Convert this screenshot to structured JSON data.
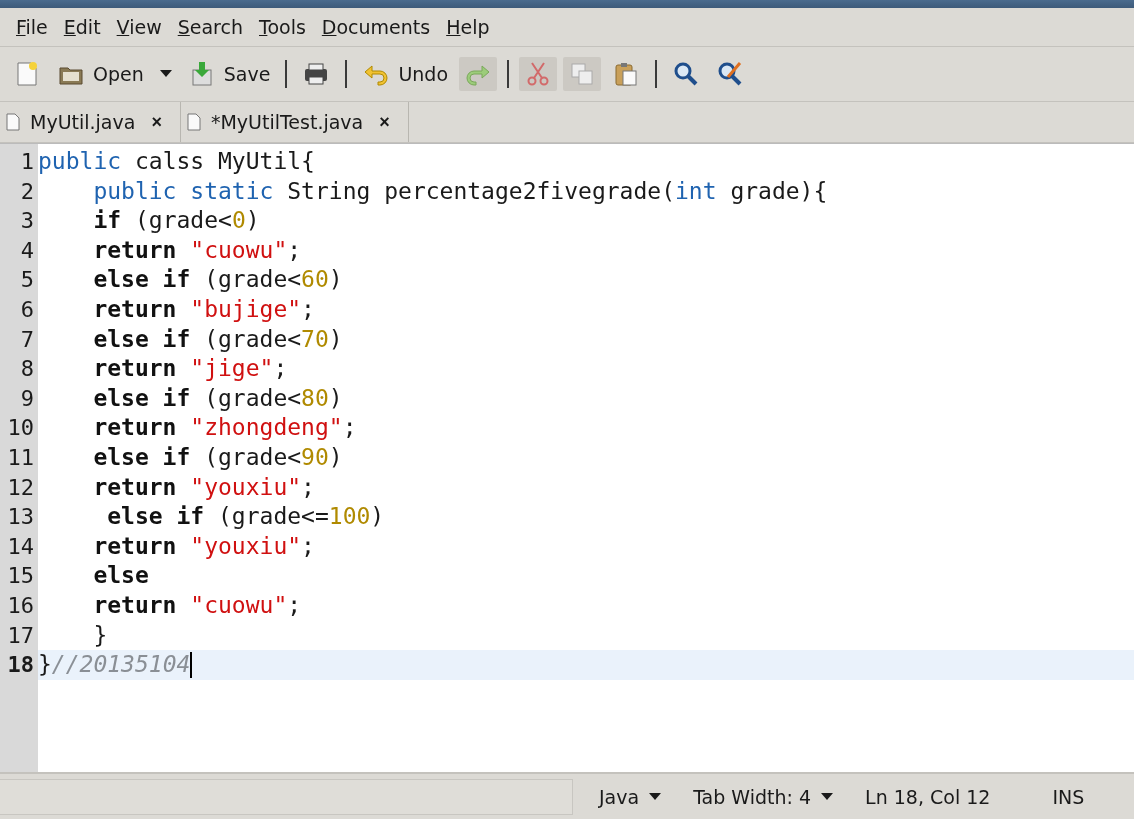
{
  "menu": [
    {
      "label": "File"
    },
    {
      "label": "Edit"
    },
    {
      "label": "View"
    },
    {
      "label": "Search"
    },
    {
      "label": "Tools"
    },
    {
      "label": "Documents"
    },
    {
      "label": "Help"
    }
  ],
  "toolbar": [
    {
      "kind": "new",
      "disabled": false
    },
    {
      "kind": "open",
      "label": "Open",
      "disabled": false
    },
    {
      "kind": "dropdown",
      "disabled": false
    },
    {
      "kind": "save",
      "label": "Save",
      "disabled": false
    },
    {
      "kind": "separator"
    },
    {
      "kind": "print",
      "disabled": false
    },
    {
      "kind": "separator"
    },
    {
      "kind": "undo",
      "label": "Undo",
      "disabled": false
    },
    {
      "kind": "redo",
      "disabled": true
    },
    {
      "kind": "separator"
    },
    {
      "kind": "cut",
      "disabled": true
    },
    {
      "kind": "copy",
      "disabled": true
    },
    {
      "kind": "paste",
      "disabled": false
    },
    {
      "kind": "separator"
    },
    {
      "kind": "find",
      "disabled": false
    },
    {
      "kind": "replace",
      "disabled": false
    }
  ],
  "tabs": [
    {
      "label": "MyUtil.java",
      "close": "×"
    },
    {
      "label": "*MyUtilTest.java",
      "close": "×"
    }
  ],
  "editor": {
    "lines": [
      {
        "number": "1",
        "current": false,
        "tokens": [
          {
            "kind": "keyword",
            "text": "public"
          },
          {
            "kind": "plain",
            "text": " calss MyUtil{"
          }
        ]
      },
      {
        "number": "2",
        "current": false,
        "tokens": [
          {
            "kind": "keyword",
            "text": "    public static"
          },
          {
            "kind": "plain",
            "text": " String percentage2fivegrade("
          },
          {
            "kind": "keyword",
            "text": "int"
          },
          {
            "kind": "plain",
            "text": " grade){"
          }
        ]
      },
      {
        "number": "3",
        "current": false,
        "tokens": [
          {
            "kind": "bold",
            "text": "    if"
          },
          {
            "kind": "plain",
            "text": " (grade<"
          },
          {
            "kind": "number",
            "text": "0"
          },
          {
            "kind": "plain",
            "text": ")"
          }
        ]
      },
      {
        "number": "4",
        "current": false,
        "tokens": [
          {
            "kind": "bold",
            "text": "    return"
          },
          {
            "kind": "string",
            "text": " \"cuowu\""
          },
          {
            "kind": "plain",
            "text": ";"
          }
        ]
      },
      {
        "number": "5",
        "current": false,
        "tokens": [
          {
            "kind": "bold",
            "text": "    else if"
          },
          {
            "kind": "plain",
            "text": " (grade<"
          },
          {
            "kind": "number",
            "text": "60"
          },
          {
            "kind": "plain",
            "text": ")"
          }
        ]
      },
      {
        "number": "6",
        "current": false,
        "tokens": [
          {
            "kind": "bold",
            "text": "    return"
          },
          {
            "kind": "string",
            "text": " \"bujige\""
          },
          {
            "kind": "plain",
            "text": ";"
          }
        ]
      },
      {
        "number": "7",
        "current": false,
        "tokens": [
          {
            "kind": "bold",
            "text": "    else if"
          },
          {
            "kind": "plain",
            "text": " (grade<"
          },
          {
            "kind": "number",
            "text": "70"
          },
          {
            "kind": "plain",
            "text": ")"
          }
        ]
      },
      {
        "number": "8",
        "current": false,
        "tokens": [
          {
            "kind": "bold",
            "text": "    return"
          },
          {
            "kind": "string",
            "text": " \"jige\""
          },
          {
            "kind": "plain",
            "text": ";"
          }
        ]
      },
      {
        "number": "9",
        "current": false,
        "tokens": [
          {
            "kind": "bold",
            "text": "    else if"
          },
          {
            "kind": "plain",
            "text": " (grade<"
          },
          {
            "kind": "number",
            "text": "80"
          },
          {
            "kind": "plain",
            "text": ")"
          }
        ]
      },
      {
        "number": "10",
        "current": false,
        "tokens": [
          {
            "kind": "bold",
            "text": "    return"
          },
          {
            "kind": "string",
            "text": " \"zhongdeng\""
          },
          {
            "kind": "plain",
            "text": ";"
          }
        ]
      },
      {
        "number": "11",
        "current": false,
        "tokens": [
          {
            "kind": "bold",
            "text": "    else if"
          },
          {
            "kind": "plain",
            "text": " (grade<"
          },
          {
            "kind": "number",
            "text": "90"
          },
          {
            "kind": "plain",
            "text": ")"
          }
        ]
      },
      {
        "number": "12",
        "current": false,
        "tokens": [
          {
            "kind": "bold",
            "text": "    return"
          },
          {
            "kind": "string",
            "text": " \"youxiu\""
          },
          {
            "kind": "plain",
            "text": ";"
          }
        ]
      },
      {
        "number": "13",
        "current": false,
        "tokens": [
          {
            "kind": "bold",
            "text": "     else if"
          },
          {
            "kind": "plain",
            "text": " (grade<="
          },
          {
            "kind": "number",
            "text": "100"
          },
          {
            "kind": "plain",
            "text": ")"
          }
        ]
      },
      {
        "number": "14",
        "current": false,
        "tokens": [
          {
            "kind": "bold",
            "text": "    return"
          },
          {
            "kind": "string",
            "text": " \"youxiu\""
          },
          {
            "kind": "plain",
            "text": ";"
          }
        ]
      },
      {
        "number": "15",
        "current": false,
        "tokens": [
          {
            "kind": "bold",
            "text": "    else"
          }
        ]
      },
      {
        "number": "16",
        "current": false,
        "tokens": [
          {
            "kind": "bold",
            "text": "    return"
          },
          {
            "kind": "string",
            "text": " \"cuowu\""
          },
          {
            "kind": "plain",
            "text": ";"
          }
        ]
      },
      {
        "number": "17",
        "current": false,
        "tokens": [
          {
            "kind": "plain",
            "text": "    }"
          }
        ]
      },
      {
        "number": "18",
        "current": true,
        "tokens": [
          {
            "kind": "plain",
            "text": "}"
          },
          {
            "kind": "comment",
            "text": "//20135104"
          }
        ]
      }
    ]
  },
  "status_bar": {
    "language": "Java",
    "tab_width": "Tab Width: 4",
    "position": "Ln 18, Col 12",
    "mode": "INS"
  }
}
